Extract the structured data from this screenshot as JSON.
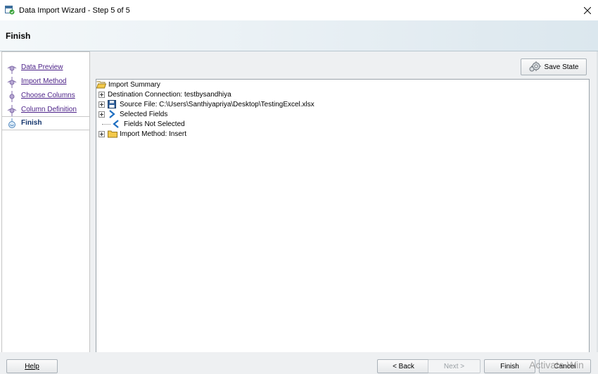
{
  "window": {
    "title": "Data Import Wizard - Step 5 of 5"
  },
  "header": {
    "title": "Finish"
  },
  "sidebar": {
    "steps": [
      {
        "label": "Data Preview"
      },
      {
        "label": "Import Method"
      },
      {
        "label": "Choose Columns"
      },
      {
        "label": "Column Definition"
      },
      {
        "label": "Finish"
      }
    ]
  },
  "toolbar": {
    "save_state_label": "Save State"
  },
  "tree": {
    "root": "Import Summary",
    "items": [
      {
        "label": "Destination Connection: testbysandhiya"
      },
      {
        "label": "Source File: C:\\Users\\Santhiyapriya\\Desktop\\TestingExcel.xlsx"
      },
      {
        "label": "Selected Fields"
      },
      {
        "label": "Fields Not Selected"
      },
      {
        "label": "Import Method: Insert"
      }
    ]
  },
  "footer": {
    "help_label": "Help",
    "back_label": "< Back",
    "next_label": "Next >",
    "finish_label": "Finish",
    "cancel_label": "Cancel",
    "watermark": "Activate Win"
  },
  "colors": {
    "accent": "#4a1f87",
    "header_bg": "#e6eef3"
  }
}
